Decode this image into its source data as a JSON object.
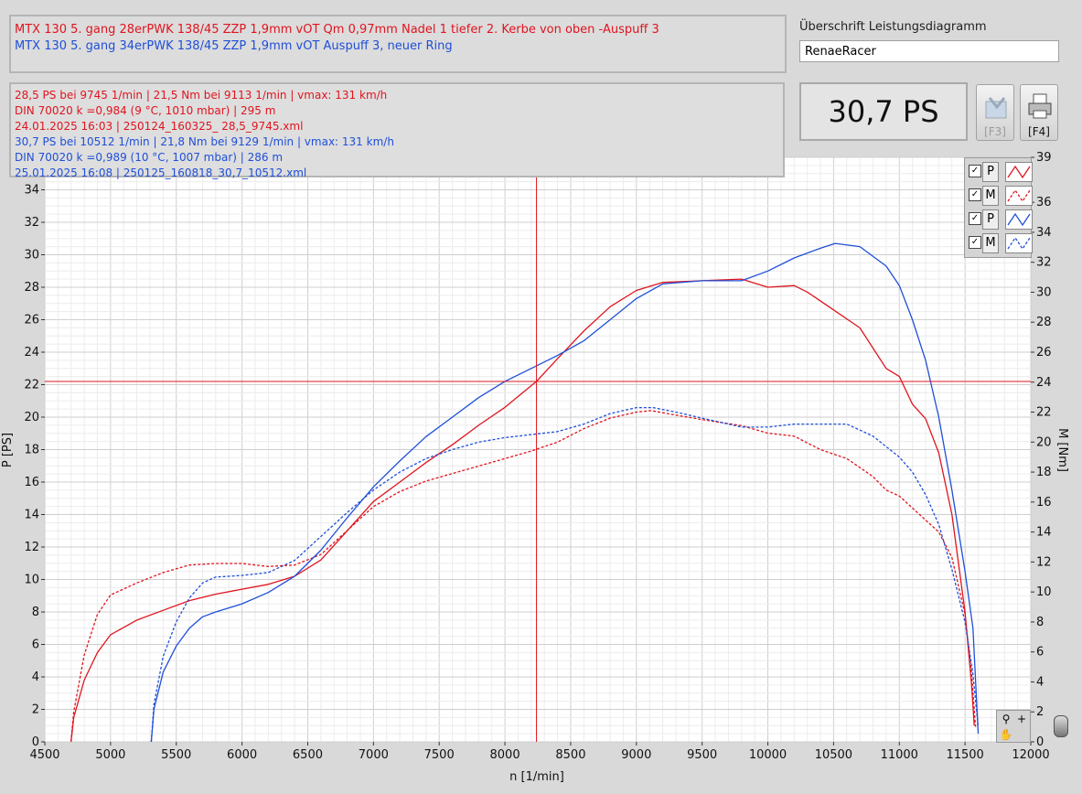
{
  "desc": {
    "line1": "MTX 130 5. gang 28erPWK 138/45 ZZP 1,9mm vOT Qm 0,97mm Nadel 1 tiefer 2. Kerbe von oben -Auspuff 3",
    "line2": "MTX 130 5. gang 34erPWK 138/45 ZZP 1,9mm vOT Auspuff 3, neuer Ring"
  },
  "stats": {
    "red1": "28,5 PS bei 9745 1/min   |   21,5 Nm bei 9113 1/min   |   vmax: 131 km/h",
    "red2": "DIN 70020 k =0,984 (9 °C, 1010 mbar)   |   295 m",
    "red3": "24.01.2025 16:03 | 250124_160325_ 28,5_9745.xml",
    "blue1": "30,7 PS bei 10512 1/min   |   21,8 Nm bei 9129 1/min   |   vmax: 131 km/h",
    "blue2": "DIN 70020 k =0,989 (10 °C, 1007 mbar)   |   286 m",
    "blue3": "25.01.2025 16:08 | 250125_160818_30,7_10512.xml"
  },
  "title_field": {
    "label": "Überschrift Leistungsdiagramm",
    "value": "RenaeRacer"
  },
  "ps_display": "30,7 PS",
  "buttons": {
    "f3": "[F3]",
    "f4": "[F4]"
  },
  "legend": [
    {
      "letter": "P",
      "checked": true,
      "color": "#e0141e",
      "dashed": false
    },
    {
      "letter": "M",
      "checked": true,
      "color": "#e0141e",
      "dashed": true
    },
    {
      "letter": "P",
      "checked": true,
      "color": "#1f4fd8",
      "dashed": false
    },
    {
      "letter": "M",
      "checked": true,
      "color": "#1f4fd8",
      "dashed": true
    }
  ],
  "colors": {
    "red": "#e0141e",
    "blue": "#1f4fd8"
  },
  "chart_data": {
    "type": "line",
    "xlabel": "n [1/min]",
    "ylabel": "P [PS]",
    "y2label": "M [Nm]",
    "xlim": [
      4500,
      12000
    ],
    "ylim": [
      0,
      36
    ],
    "y2lim": [
      0,
      39
    ],
    "x_ticks": [
      4500,
      5000,
      5500,
      6000,
      6500,
      7000,
      7500,
      8000,
      8500,
      9000,
      9500,
      10000,
      10500,
      11000,
      11500,
      12000
    ],
    "y_ticks": [
      0,
      2,
      4,
      6,
      8,
      10,
      12,
      14,
      16,
      18,
      20,
      22,
      24,
      26,
      28,
      30,
      32,
      34
    ],
    "y2_ticks": [
      0,
      2,
      4,
      6,
      8,
      10,
      12,
      14,
      16,
      18,
      20,
      22,
      24,
      26,
      28,
      30,
      32,
      34,
      36,
      39
    ],
    "grid": true,
    "cursor": {
      "x": 8240,
      "y": 22.2
    },
    "series": [
      {
        "color": "#e0141e",
        "dashed": false,
        "axis": "left",
        "points": [
          [
            4700,
            0
          ],
          [
            4720,
            1.5
          ],
          [
            4800,
            3.8
          ],
          [
            4900,
            5.5
          ],
          [
            5000,
            6.6
          ],
          [
            5200,
            7.5
          ],
          [
            5400,
            8.1
          ],
          [
            5600,
            8.7
          ],
          [
            5800,
            9.1
          ],
          [
            6000,
            9.4
          ],
          [
            6200,
            9.7
          ],
          [
            6400,
            10.2
          ],
          [
            6600,
            11.2
          ],
          [
            6800,
            13.0
          ],
          [
            7000,
            14.8
          ],
          [
            7200,
            16.0
          ],
          [
            7400,
            17.2
          ],
          [
            7600,
            18.3
          ],
          [
            7800,
            19.5
          ],
          [
            8000,
            20.6
          ],
          [
            8240,
            22.2
          ],
          [
            8400,
            23.6
          ],
          [
            8600,
            25.3
          ],
          [
            8800,
            26.8
          ],
          [
            9000,
            27.8
          ],
          [
            9200,
            28.3
          ],
          [
            9500,
            28.4
          ],
          [
            9800,
            28.5
          ],
          [
            10000,
            28.0
          ],
          [
            10200,
            28.1
          ],
          [
            10300,
            27.7
          ],
          [
            10500,
            26.6
          ],
          [
            10700,
            25.5
          ],
          [
            10900,
            23.0
          ],
          [
            11000,
            22.5
          ],
          [
            11100,
            20.8
          ],
          [
            11200,
            19.9
          ],
          [
            11300,
            17.8
          ],
          [
            11400,
            14.0
          ],
          [
            11500,
            8.0
          ],
          [
            11550,
            3.5
          ],
          [
            11570,
            1.0
          ]
        ]
      },
      {
        "color": "#e0141e",
        "dashed": true,
        "axis": "right",
        "points": [
          [
            4700,
            0
          ],
          [
            4720,
            2.0
          ],
          [
            4800,
            5.8
          ],
          [
            4900,
            8.5
          ],
          [
            5000,
            9.8
          ],
          [
            5200,
            10.6
          ],
          [
            5400,
            11.3
          ],
          [
            5600,
            11.8
          ],
          [
            5800,
            11.9
          ],
          [
            6000,
            11.9
          ],
          [
            6200,
            11.7
          ],
          [
            6400,
            11.8
          ],
          [
            6600,
            12.5
          ],
          [
            6800,
            14.1
          ],
          [
            7000,
            15.7
          ],
          [
            7200,
            16.7
          ],
          [
            7400,
            17.4
          ],
          [
            7600,
            17.9
          ],
          [
            7800,
            18.4
          ],
          [
            8000,
            18.9
          ],
          [
            8200,
            19.4
          ],
          [
            8400,
            20.0
          ],
          [
            8600,
            20.9
          ],
          [
            8800,
            21.6
          ],
          [
            9000,
            22.0
          ],
          [
            9113,
            22.1
          ],
          [
            9300,
            21.8
          ],
          [
            9500,
            21.5
          ],
          [
            9800,
            21.1
          ],
          [
            10000,
            20.6
          ],
          [
            10200,
            20.4
          ],
          [
            10400,
            19.5
          ],
          [
            10600,
            18.9
          ],
          [
            10800,
            17.7
          ],
          [
            10900,
            16.8
          ],
          [
            11000,
            16.4
          ],
          [
            11200,
            14.8
          ],
          [
            11300,
            14.0
          ],
          [
            11400,
            12.3
          ],
          [
            11500,
            8.5
          ],
          [
            11550,
            4.5
          ],
          [
            11580,
            1.0
          ]
        ]
      },
      {
        "color": "#1f4fd8",
        "dashed": false,
        "axis": "left",
        "points": [
          [
            5310,
            0
          ],
          [
            5330,
            2.0
          ],
          [
            5400,
            4.3
          ],
          [
            5500,
            5.9
          ],
          [
            5600,
            7.0
          ],
          [
            5700,
            7.7
          ],
          [
            5800,
            8.0
          ],
          [
            6000,
            8.5
          ],
          [
            6200,
            9.2
          ],
          [
            6400,
            10.2
          ],
          [
            6600,
            11.8
          ],
          [
            6800,
            13.8
          ],
          [
            7000,
            15.7
          ],
          [
            7200,
            17.3
          ],
          [
            7400,
            18.8
          ],
          [
            7600,
            20.0
          ],
          [
            7800,
            21.2
          ],
          [
            8000,
            22.2
          ],
          [
            8200,
            23.0
          ],
          [
            8400,
            23.8
          ],
          [
            8600,
            24.7
          ],
          [
            8800,
            26.0
          ],
          [
            9000,
            27.3
          ],
          [
            9200,
            28.2
          ],
          [
            9500,
            28.4
          ],
          [
            9800,
            28.4
          ],
          [
            10000,
            29.0
          ],
          [
            10200,
            29.8
          ],
          [
            10400,
            30.4
          ],
          [
            10512,
            30.7
          ],
          [
            10700,
            30.5
          ],
          [
            10900,
            29.3
          ],
          [
            11000,
            28.1
          ],
          [
            11100,
            26.0
          ],
          [
            11200,
            23.5
          ],
          [
            11300,
            20.0
          ],
          [
            11400,
            15.5
          ],
          [
            11500,
            10.5
          ],
          [
            11560,
            7.0
          ],
          [
            11600,
            0.5
          ]
        ]
      },
      {
        "color": "#1f4fd8",
        "dashed": true,
        "axis": "right",
        "points": [
          [
            5310,
            0
          ],
          [
            5330,
            2.5
          ],
          [
            5400,
            5.7
          ],
          [
            5500,
            8.0
          ],
          [
            5600,
            9.6
          ],
          [
            5700,
            10.6
          ],
          [
            5800,
            11.0
          ],
          [
            6000,
            11.1
          ],
          [
            6200,
            11.3
          ],
          [
            6400,
            12.1
          ],
          [
            6600,
            13.7
          ],
          [
            6800,
            15.3
          ],
          [
            7000,
            16.8
          ],
          [
            7200,
            18.0
          ],
          [
            7400,
            18.9
          ],
          [
            7600,
            19.5
          ],
          [
            7800,
            20.0
          ],
          [
            8000,
            20.3
          ],
          [
            8200,
            20.5
          ],
          [
            8400,
            20.7
          ],
          [
            8600,
            21.2
          ],
          [
            8800,
            21.9
          ],
          [
            9000,
            22.3
          ],
          [
            9129,
            22.3
          ],
          [
            9300,
            22.0
          ],
          [
            9500,
            21.6
          ],
          [
            9800,
            21.0
          ],
          [
            10000,
            21.0
          ],
          [
            10200,
            21.2
          ],
          [
            10400,
            21.2
          ],
          [
            10600,
            21.2
          ],
          [
            10800,
            20.4
          ],
          [
            11000,
            19.0
          ],
          [
            11100,
            18.0
          ],
          [
            11200,
            16.5
          ],
          [
            11300,
            14.5
          ],
          [
            11400,
            11.5
          ],
          [
            11500,
            8.0
          ],
          [
            11560,
            4.5
          ],
          [
            11600,
            1.0
          ]
        ]
      }
    ]
  }
}
